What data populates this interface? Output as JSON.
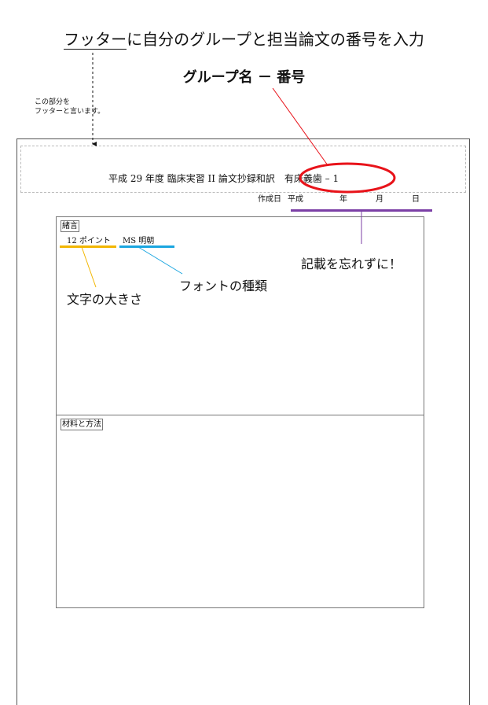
{
  "header": {
    "title_underlined": "フッター",
    "title_rest": "に自分のグループと担当論文の番号を入力",
    "group_label": "グループ名 － 番号"
  },
  "note": {
    "line1": "この部分を",
    "line2": "フッターと言います。"
  },
  "footer": {
    "course": "平成 29 年度 臨床実習 II 論文抄録和訳",
    "group": "有床義歯 – 1"
  },
  "date": {
    "label": "作成日",
    "era": "平成",
    "year": "年",
    "month": "月",
    "day": "日"
  },
  "sections": [
    {
      "label": "緒言"
    },
    {
      "label": "材料と方法"
    }
  ],
  "sample": {
    "size": "12 ポイント",
    "font": "MS 明朝"
  },
  "annotations": {
    "reminder": "記載を忘れずに！",
    "font_type": "フォントの種類",
    "char_size": "文字の大きさ"
  },
  "colors": {
    "highlight_circle": "#e8131a",
    "pointer_red": "#e8131a",
    "date_underline": "#7b3fa6",
    "size_underline": "#f2b600",
    "font_underline": "#1aa6e0"
  }
}
